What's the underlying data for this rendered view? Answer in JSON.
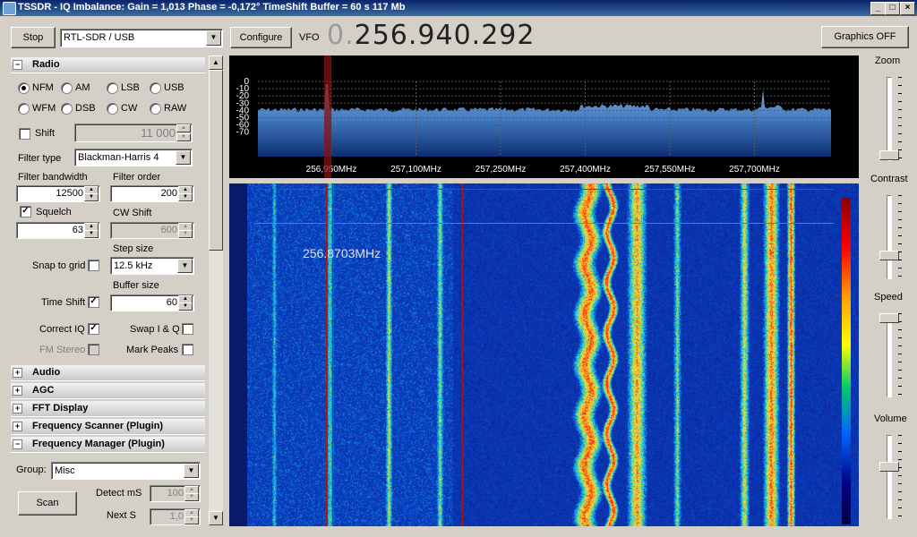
{
  "window": {
    "title": "TSSDR - IQ Imbalance: Gain = 1,013 Phase = -0,172° TimeShift Buffer = 60 s  117 Mb",
    "buttons": [
      "_",
      "□",
      "×"
    ]
  },
  "toolbar": {
    "stop_label": "Stop",
    "device": "RTL-SDR / USB",
    "configure_label": "Configure",
    "vfo_label": "VFO",
    "vfo_lead": "0.",
    "vfo_value": "256.940.292",
    "graphics_label": "Graphics OFF"
  },
  "radio": {
    "header": "Radio",
    "modes": [
      {
        "label": "NFM",
        "selected": true
      },
      {
        "label": "AM",
        "selected": false
      },
      {
        "label": "LSB",
        "selected": false
      },
      {
        "label": "USB",
        "selected": false
      },
      {
        "label": "WFM",
        "selected": false
      },
      {
        "label": "DSB",
        "selected": false
      },
      {
        "label": "CW",
        "selected": false
      },
      {
        "label": "RAW",
        "selected": false
      }
    ],
    "shift_label": "Shift",
    "shift_value": "11 000",
    "filter_type_label": "Filter type",
    "filter_type": "Blackman-Harris 4",
    "filter_bandwidth_label": "Filter bandwidth",
    "filter_bandwidth": "12500",
    "filter_order_label": "Filter order",
    "filter_order": "200",
    "squelch_label": "Squelch",
    "squelch_value": "63",
    "cw_shift_label": "CW Shift",
    "cw_shift_value": "600",
    "step_size_label": "Step size",
    "step_size": "12.5 kHz",
    "snap_label": "Snap to grid",
    "buffer_size_label": "Buffer size",
    "buffer_size": "60",
    "time_shift_label": "Time Shift",
    "correct_iq_label": "Correct IQ",
    "swap_iq_label": "Swap I & Q",
    "fm_stereo_label": "FM Stereo",
    "mark_peaks_label": "Mark Peaks"
  },
  "sections": [
    "Audio",
    "AGC",
    "FFT Display",
    "Frequency Scanner (Plugin)",
    "Frequency Manager (Plugin)"
  ],
  "freq_manager": {
    "group_label": "Group:",
    "group_value": "Misc",
    "scan_label": "Scan",
    "detect_label": "Detect mS",
    "detect_value": "100",
    "next_label": "Next   S",
    "next_value": "1,0"
  },
  "spectrum": {
    "y_ticks": [
      "0",
      "-10",
      "-20",
      "-30",
      "-40",
      "-50",
      "-60",
      "-70"
    ],
    "x_ticks": [
      "256,950MHz",
      "257,100MHz",
      "257,250MHz",
      "257,400MHz",
      "257,550MHz",
      "257,700MHz"
    ]
  },
  "waterfall": {
    "cursor_label": "256.8703MHz"
  },
  "sliders": {
    "zoom": "Zoom",
    "contrast": "Contrast",
    "speed": "Speed",
    "volume": "Volume"
  },
  "colors": {
    "titlebar": "#0a246a",
    "waterfall_bg": "#03125e",
    "spectrum_fill": "#4a7fc0",
    "marker": "#cc0000"
  }
}
